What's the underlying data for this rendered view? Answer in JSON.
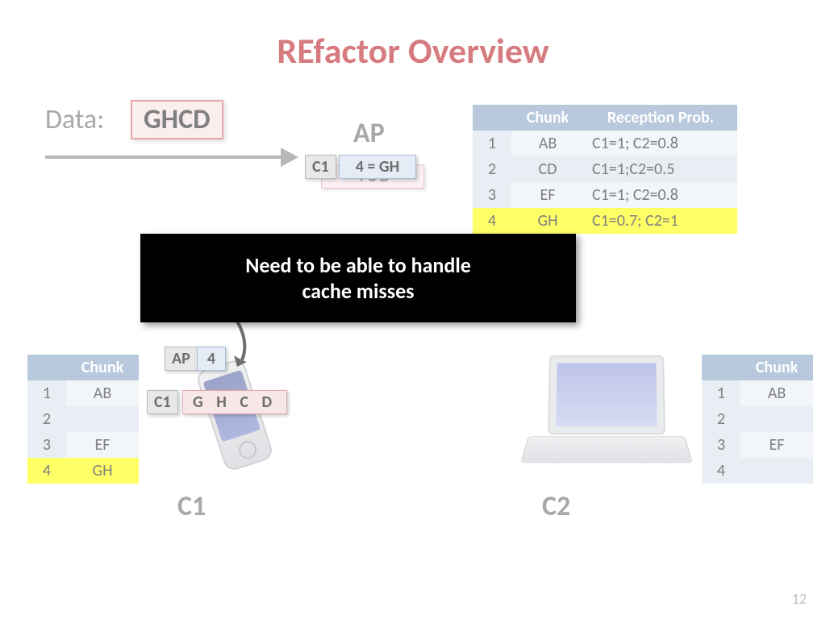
{
  "title": "REfactor Overview",
  "data_label": "Data:",
  "data_value": "GHCD",
  "ap_label": "AP",
  "ap_chip_src": "C1",
  "ap_chip_eq": "4 = GH",
  "ap_chip_behind": "4  C  D",
  "top_table": {
    "headers": [
      "",
      "Chunk",
      "Reception Prob."
    ],
    "rows": [
      {
        "i": "1",
        "chunk": "AB",
        "rp": "C1=1;  C2=0.8",
        "hl": false
      },
      {
        "i": "2",
        "chunk": "CD",
        "rp": "C1=1;C2=0.5",
        "hl": false
      },
      {
        "i": "3",
        "chunk": "EF",
        "rp": "C1=1;  C2=0.8",
        "hl": false
      },
      {
        "i": "4",
        "chunk": "GH",
        "rp": "C1=0.7; C2=1",
        "hl": true
      }
    ]
  },
  "overlay_line1": "Need to be able to handle",
  "overlay_line2": "cache misses",
  "c1_ap_chip": "AP",
  "c1_num_chip": "4",
  "c1_src_chip": "C1",
  "c1_ghcd": "G H C D",
  "left_table": {
    "headers": [
      "",
      "Chunk"
    ],
    "rows": [
      {
        "i": "1",
        "chunk": "AB",
        "hl": false
      },
      {
        "i": "2",
        "chunk": "",
        "hl": false
      },
      {
        "i": "3",
        "chunk": "EF",
        "hl": false
      },
      {
        "i": "4",
        "chunk": "GH",
        "hl": true
      }
    ]
  },
  "right_table": {
    "headers": [
      "",
      "Chunk"
    ],
    "rows": [
      {
        "i": "1",
        "chunk": "AB",
        "hl": false
      },
      {
        "i": "2",
        "chunk": "",
        "hl": false
      },
      {
        "i": "3",
        "chunk": "EF",
        "hl": false
      },
      {
        "i": "4",
        "chunk": "",
        "hl": false
      }
    ]
  },
  "c1_label": "C1",
  "c2_label": "C2",
  "page_number": "12"
}
